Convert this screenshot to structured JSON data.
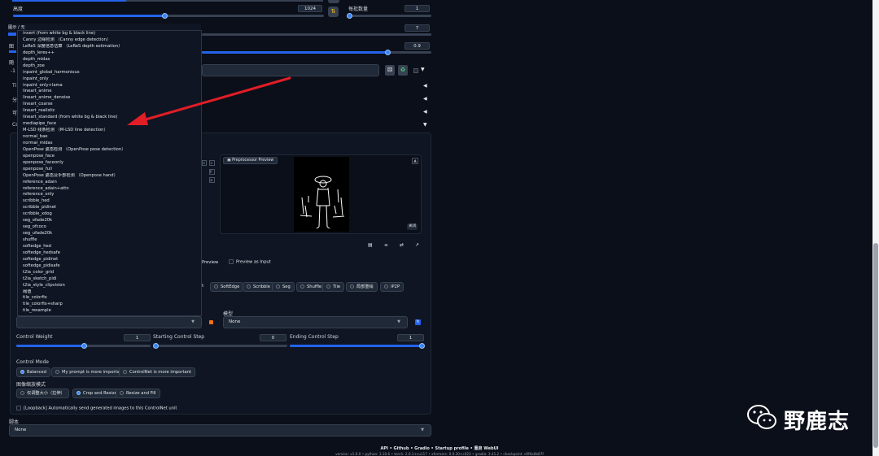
{
  "top": {
    "height_label": "高度",
    "height_value": "1024",
    "batch_label": "每批数量",
    "batch_value": "1",
    "cfg_value": "7",
    "denoise_value": "0.9",
    "side_labels": [
      "图",
      "迭",
      "随",
      "-1",
      "Ti",
      "分",
      "可",
      "Co"
    ]
  },
  "dropdown": {
    "header": "图示 / 无",
    "items": [
      "invert (from white bg & black line)",
      "Canny 边缘检测 （Canny edge detection）",
      "LeReS 深度信息估算 （LeReS depth estimation）",
      "depth_leres++",
      "depth_midas",
      "depth_zoe",
      "inpaint_global_harmonious",
      "inpaint_only",
      "inpaint_only+lama",
      "lineart_anime",
      "lineart_anime_denoise",
      "lineart_coarse",
      "lineart_realistic",
      "lineart_standard (from white bg & black line)",
      "mediapipe_face",
      "M-LSD 线条检测 （M-LSD line detection）",
      "normal_bae",
      "normal_midas",
      "OpenPose 姿态检测 （OpenPose pose detection）",
      "openpose_face",
      "openpose_faceonly",
      "openpose_full",
      "OpenPose 姿态及手部检测 （Openpose hand）",
      "reference_adain",
      "reference_adain+attn",
      "reference_only",
      "scribble_hed",
      "scribble_pidinet",
      "scribble_xdog",
      "seg_ofade20k",
      "seg_ofcoco",
      "seg_ufade20k",
      "shuffle",
      "softedge_hed",
      "softedge_hedsafe",
      "softedge_pidinet",
      "softedge_pidisafe",
      "t2ia_color_grid",
      "t2ia_sketch_pidi",
      "t2ia_style_clipvision",
      "阈值",
      "tile_colorfix",
      "tile_colorfix+sharp",
      "tile_resample"
    ]
  },
  "preview": {
    "title": "Preprocessor Preview",
    "close_label": "关闭"
  },
  "options": {
    "preview_label": "Preview",
    "preview_as_input": "Preview as Input"
  },
  "control_types": [
    "rt",
    "SoftEdge",
    "Scribble",
    "Seg",
    "Shuffle",
    "Tile",
    "局部重绘",
    "IP2P"
  ],
  "model": {
    "label": "模型",
    "value": "None"
  },
  "sliders": {
    "weight_label": "Control Weight",
    "weight_value": "1",
    "start_label": "Starting Control Step",
    "start_value": "0",
    "end_label": "Ending Control Step",
    "end_value": "1"
  },
  "control_mode": {
    "label": "Control Mode",
    "options": [
      "Balanced",
      "My prompt is more important",
      "ControlNet is more important"
    ]
  },
  "resize_mode": {
    "label": "图像缩放模式",
    "options": [
      "仅调整大小（拉伸）",
      "Crop and Resize",
      "Resize and Fill"
    ]
  },
  "loopback_label": "[Loopback] Automatically send generated images to this ControlNet unit",
  "script": {
    "label": "脚本",
    "value": "None"
  },
  "footer": {
    "links": "API  •  Github  •  Gradio  •  Startup profile  •  重启 WebUI",
    "version": "version: v1.6.0  •  python: 3.10.6  •  torch: 2.0.1+cu117  •  xformers: 0.0.20+c023  •  gradio: 3.41.2  •  checkpoint: c6f6a0b87f"
  },
  "watermark": "野鹿志",
  "colors": {
    "accent": "#2563eb",
    "arrow": "#e11d26",
    "bg": "#0b0f19"
  }
}
